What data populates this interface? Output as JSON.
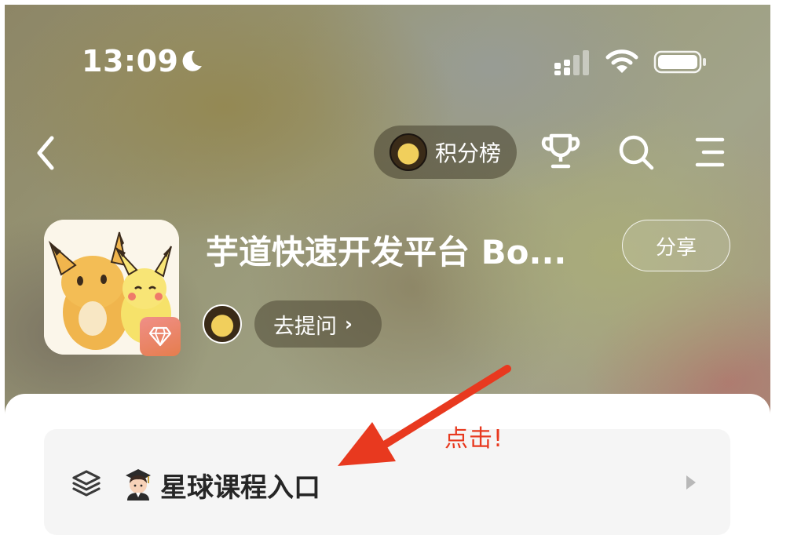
{
  "status_bar": {
    "time": "13:09",
    "moon_icon": "moon-icon",
    "signal_icon": "signal-icon",
    "wifi_icon": "wifi-icon",
    "battery_icon": "battery-icon"
  },
  "nav": {
    "back_icon": "chevron-left-icon",
    "rank_label": "积分榜",
    "trophy_icon": "trophy-icon",
    "search_icon": "search-icon",
    "menu_icon": "menu-icon"
  },
  "group": {
    "title": "芋道快速开发平台 Bo...",
    "share_label": "分享",
    "ask_label": "去提问",
    "ask_chevron": "›",
    "badge_icon": "diamond-icon"
  },
  "course_entry": {
    "emoji": "👩‍🎓",
    "label": "星球课程入口",
    "leading_icon": "layers-icon",
    "trailing_icon": "play-arrow-icon"
  },
  "annotation": {
    "text": "点击!",
    "color": "#e8391f"
  },
  "colors": {
    "accent_red": "#e8391f",
    "card_bg": "#f5f5f5",
    "text_dark": "#262626"
  }
}
